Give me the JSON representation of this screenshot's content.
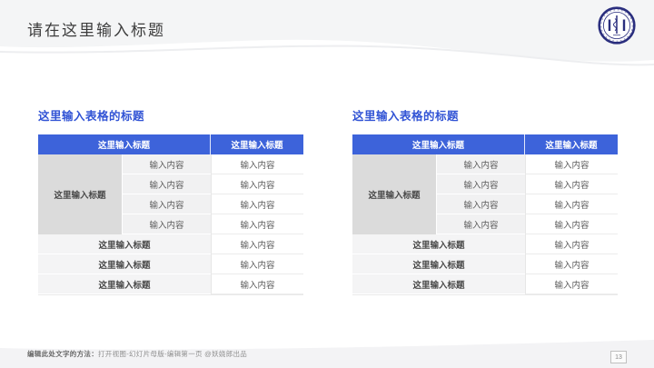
{
  "slide": {
    "title": "请在这里输入标题",
    "page_number": "13",
    "footer_lead": "编辑此处文字的方法：",
    "footer_rest": "打开视图-幻灯片母版-编辑第一页 @妖娆郎出品",
    "logo_icon": "university-emblem-logo"
  },
  "colors": {
    "accent_blue_header": "#3D63DA",
    "table_title_blue": "#3254D5",
    "top_bottom_band_gray": "#F4F5F6",
    "merged_cell_gray": "#DBDBDB",
    "stripe_cell_gray": "#F1F1F2",
    "summary_cell_gray": "#F4F4F5",
    "logo_navy": "#2A2E7E"
  },
  "tables": [
    {
      "title": "这里输入表格的标题",
      "header": {
        "col_main": "这里输入标题",
        "col_right": "这里输入标题"
      },
      "row_group_label": "这里输入标题",
      "detail_rows": [
        {
          "mid": "输入内容",
          "right": "输入内容"
        },
        {
          "mid": "输入内容",
          "right": "输入内容"
        },
        {
          "mid": "输入内容",
          "right": "输入内容"
        },
        {
          "mid": "输入内容",
          "right": "输入内容"
        }
      ],
      "summary_rows": [
        {
          "label": "这里输入标题",
          "right": "输入内容"
        },
        {
          "label": "这里输入标题",
          "right": "输入内容"
        },
        {
          "label": "这里输入标题",
          "right": "输入内容"
        }
      ]
    },
    {
      "title": "这里输入表格的标题",
      "header": {
        "col_main": "这里输入标题",
        "col_right": "这里输入标题"
      },
      "row_group_label": "这里输入标题",
      "detail_rows": [
        {
          "mid": "输入内容",
          "right": "输入内容"
        },
        {
          "mid": "输入内容",
          "right": "输入内容"
        },
        {
          "mid": "输入内容",
          "right": "输入内容"
        },
        {
          "mid": "输入内容",
          "right": "输入内容"
        }
      ],
      "summary_rows": [
        {
          "label": "这里输入标题",
          "right": "输入内容"
        },
        {
          "label": "这里输入标题",
          "right": "输入内容"
        },
        {
          "label": "这里输入标题",
          "right": "输入内容"
        }
      ]
    }
  ]
}
